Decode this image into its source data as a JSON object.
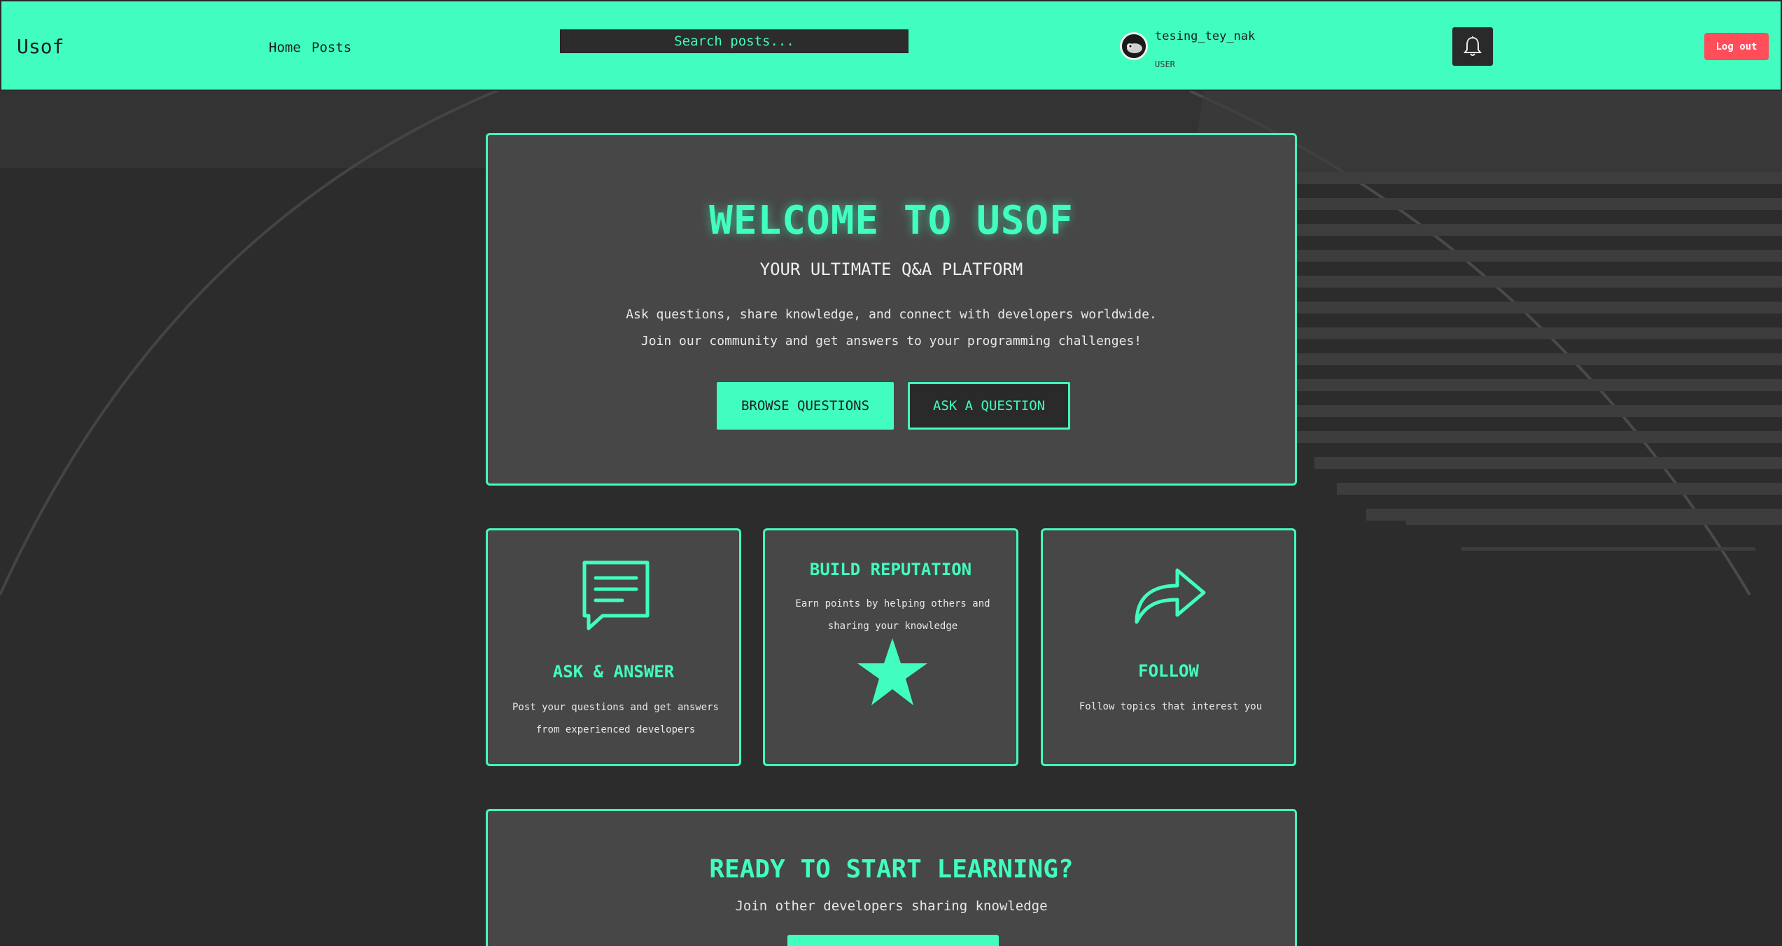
{
  "header": {
    "logo": "Usof",
    "nav": {
      "home": "Home",
      "posts": "Posts"
    },
    "search_placeholder": "Search posts...",
    "user": {
      "name": "tesing_tey_nak",
      "role": "USER"
    },
    "logout_label": "Log out",
    "bell_icon": "bell-icon"
  },
  "hero": {
    "title": "WELCOME TO USOF",
    "subtitle": "YOUR ULTIMATE Q&A PLATFORM",
    "description": "Ask questions, share knowledge, and connect with developers worldwide. Join our community and get answers to your programming challenges!",
    "primary_button": "BROWSE QUESTIONS",
    "secondary_button": "ASK A QUESTION"
  },
  "features": [
    {
      "icon": "chat-bubble-icon",
      "title": "ASK & ANSWER",
      "text": "Post your questions and get answers from experienced developers"
    },
    {
      "icon": "star-icon",
      "title": "BUILD REPUTATION",
      "text": "Earn points by helping others and sharing your knowledge"
    },
    {
      "icon": "share-arrow-icon",
      "title": "FOLLOW",
      "text": "Follow topics that interest you"
    }
  ],
  "cta": {
    "title": "READY TO START LEARNING?",
    "subtitle": "Join other developers sharing knowledge",
    "button": ""
  },
  "colors": {
    "accent": "#41fdbf",
    "background": "#2c2c2c",
    "card": "#474747",
    "danger": "#ff4d5a"
  }
}
